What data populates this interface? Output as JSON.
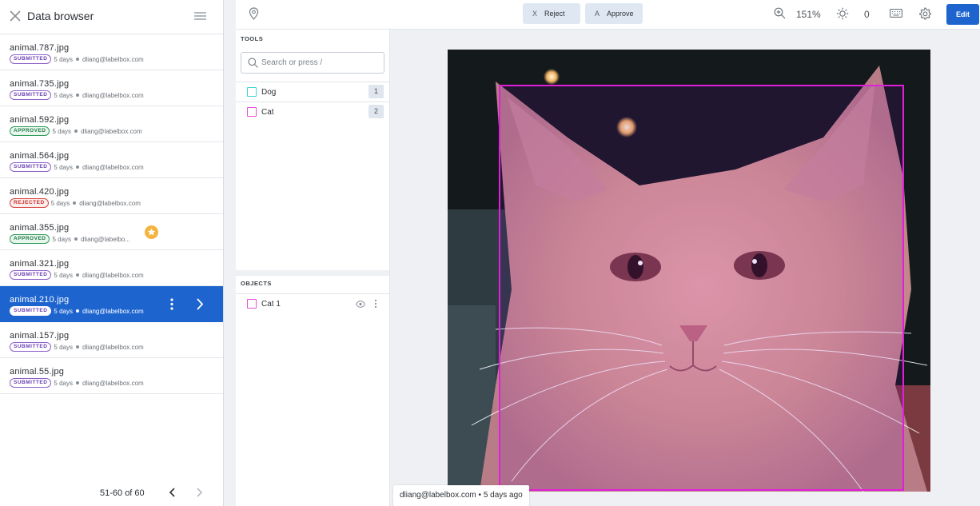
{
  "sidebar": {
    "title": "Data browser",
    "items": [
      {
        "name": "animal.787.jpg",
        "status": "SUBMITTED",
        "status_type": "submitted",
        "age": "5 days",
        "user": "dliang@labelbox.com"
      },
      {
        "name": "animal.735.jpg",
        "status": "SUBMITTED",
        "status_type": "submitted",
        "age": "5 days",
        "user": "dliang@labelbox.com"
      },
      {
        "name": "animal.592.jpg",
        "status": "APPROVED",
        "status_type": "approved",
        "age": "5 days",
        "user": "dliang@labelbox.com"
      },
      {
        "name": "animal.564.jpg",
        "status": "SUBMITTED",
        "status_type": "submitted",
        "age": "5 days",
        "user": "dliang@labelbox.com"
      },
      {
        "name": "animal.420.jpg",
        "status": "REJECTED",
        "status_type": "rejected",
        "age": "5 days",
        "user": "dliang@labelbox.com"
      },
      {
        "name": "animal.355.jpg",
        "status": "APPROVED",
        "status_type": "approved",
        "age": "5 days",
        "user": "dliang@labelbo..."
      },
      {
        "name": "animal.321.jpg",
        "status": "SUBMITTED",
        "status_type": "submitted",
        "age": "5 days",
        "user": "dliang@labelbox.com"
      },
      {
        "name": "animal.210.jpg",
        "status": "SUBMITTED",
        "status_type": "submitted",
        "age": "5 days",
        "user": "dliang@labelbox.com"
      },
      {
        "name": "animal.157.jpg",
        "status": "SUBMITTED",
        "status_type": "submitted",
        "age": "5 days",
        "user": "dliang@labelbox.com"
      },
      {
        "name": "animal.55.jpg",
        "status": "SUBMITTED",
        "status_type": "submitted",
        "age": "5 days",
        "user": "dliang@labelbox.com"
      }
    ],
    "selected_index": 7,
    "starred_index": 5,
    "pagination": {
      "label": "51-60 of 60"
    }
  },
  "toolbar": {
    "reject": {
      "key": "X",
      "label": "Reject"
    },
    "approve": {
      "key": "A",
      "label": "Approve"
    },
    "zoom": "151%",
    "brightness": "0",
    "edit_label": "Edit"
  },
  "tools_panel": {
    "title": "TOOLS",
    "search_placeholder": "Search or press /",
    "tools": [
      {
        "name": "Dog",
        "key": "1",
        "color": "#3fd6d6"
      },
      {
        "name": "Cat",
        "key": "2",
        "color": "#e84fd9"
      }
    ]
  },
  "objects_panel": {
    "title": "OBJECTS",
    "objects": [
      {
        "name": "Cat 1",
        "color": "#e84fd9"
      }
    ]
  },
  "canvas": {
    "caption": "dliang@labelbox.com • 5 days ago",
    "bbox_color": "#e020d8"
  }
}
